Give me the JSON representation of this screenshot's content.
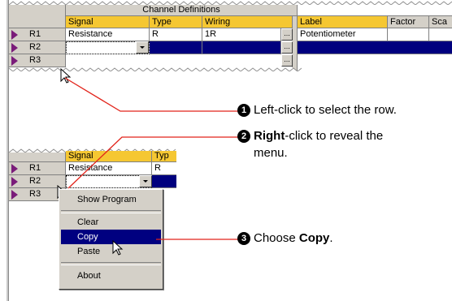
{
  "top_grid": {
    "group_header": "Channel Definitions",
    "columns": [
      "Signal",
      "Type",
      "Wiring",
      "Label",
      "Factor",
      "Sca"
    ],
    "rows": [
      {
        "id": "R1",
        "signal": "Resistance",
        "type": "R",
        "wiring": "1R",
        "ellipsis": "...",
        "label": "Potentiometer"
      },
      {
        "id": "R2",
        "ellipsis": "..."
      },
      {
        "id": "R3",
        "ellipsis": "..."
      }
    ]
  },
  "bottom_grid": {
    "columns": [
      "Signal",
      "Typ"
    ],
    "rows": [
      {
        "id": "R1",
        "signal": "Resistance",
        "type": "R"
      },
      {
        "id": "R2"
      },
      {
        "id": "R3"
      }
    ]
  },
  "context_menu": {
    "items": [
      "Show Program",
      "Clear",
      "Copy",
      "Paste",
      "About"
    ],
    "selected": "Copy"
  },
  "callouts": [
    {
      "number": "1",
      "text": "Left-click to select the row."
    },
    {
      "number": "2",
      "bold": "Right",
      "text": "-click to reveal the",
      "text2": "menu."
    },
    {
      "number": "3",
      "text": "Choose ",
      "bold": "Copy",
      "text_end": "."
    }
  ],
  "colors": {
    "header_yellow": "#f5c732",
    "selection_navy": "#00007e",
    "callout_line": "#e2231a",
    "row_arrow": "#7a1c7a"
  }
}
